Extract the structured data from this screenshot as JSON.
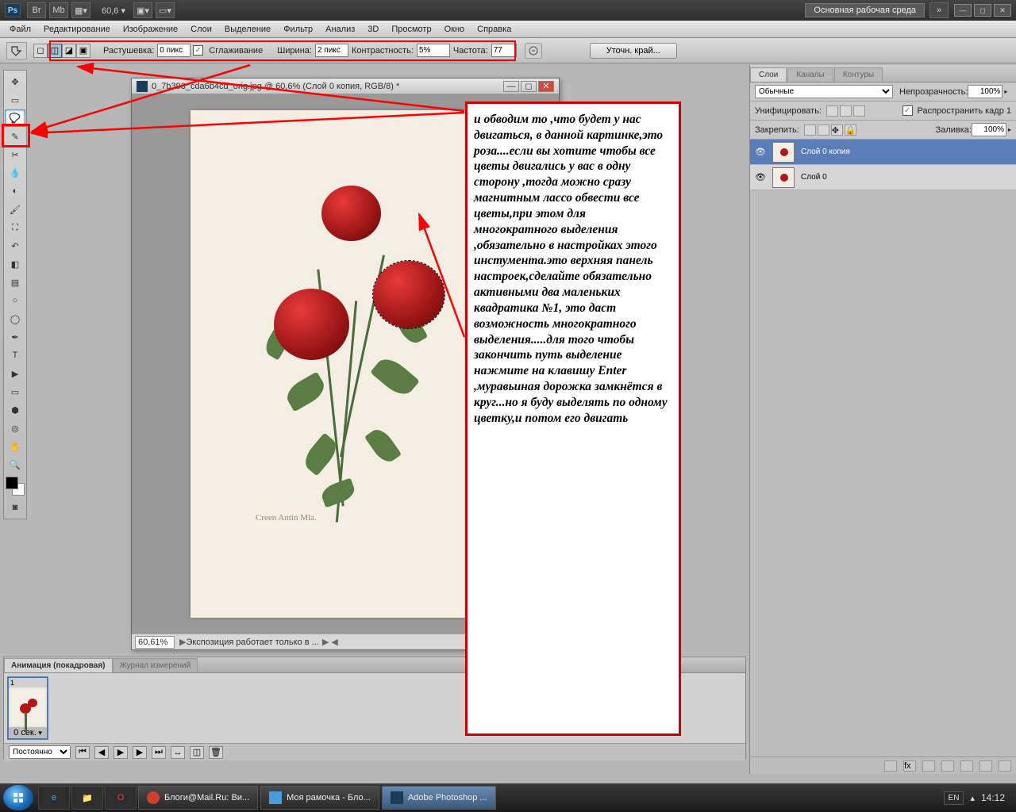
{
  "appbar": {
    "zoom": "60,6",
    "workspace_label": "Основная рабочая среда"
  },
  "menu": [
    "Файл",
    "Редактирование",
    "Изображение",
    "Слои",
    "Выделение",
    "Фильтр",
    "Анализ",
    "3D",
    "Просмотр",
    "Окно",
    "Справка"
  ],
  "options": {
    "feather_label": "Растушевка:",
    "feather_value": "0 пикс",
    "antialias_label": "Сглаживание",
    "width_label": "Ширина:",
    "width_value": "2 пикс",
    "contrast_label": "Контрастность:",
    "contrast_value": "5%",
    "frequency_label": "Частота:",
    "frequency_value": "77",
    "refine_label": "Уточн. край..."
  },
  "document": {
    "title": "0_7b393_cda6b4cd_orig.jpg @ 60,6% (Слой 0 копия, RGB/8) *",
    "status_zoom": "60,61%",
    "status_text": "Экспозиция работает только в ..."
  },
  "layers_panel": {
    "tabs": [
      "Слои",
      "Каналы",
      "Контуры"
    ],
    "blend_mode": "Обычные",
    "opacity_label": "Непрозрачность:",
    "opacity_value": "100%",
    "unify_label": "Унифицировать:",
    "propagate_label": "Распространить кадр 1",
    "lock_label": "Закрепить:",
    "fill_label": "Заливка:",
    "fill_value": "100%",
    "layers": [
      {
        "name": "Слой 0 копия",
        "selected": true
      },
      {
        "name": "Слой 0",
        "selected": false
      }
    ]
  },
  "animation": {
    "tabs": [
      "Анимация (покадровая)",
      "Журнал измерений"
    ],
    "frame_time": "0 сек.",
    "loop": "Постоянно"
  },
  "annotation": "и обводим то ,что будет у нас двигаться, в данной картинке,это роза....если вы хотите чтобы все цветы двигались у вас в одну сторону ,тогда можно сразу магнитным лассо обвести все цветы,при этом для многократного выделения ,обязательно в настройках этого инстумента.это верхняя панель настроек,сделайте обязательно активными два маленьких квадратика №1, это даст возможность многократного выделения.....для того чтобы закончить путь выделение нажмите  на клавишу Enter ,муравьиная дорожка замкнётся в круг...но я буду выделять по одному цветку,и потом его двигать",
  "taskbar": {
    "apps": [
      {
        "label": "Блоги@Mail.Ru: Ви...",
        "icon_color": "#d04030"
      },
      {
        "label": "Моя рамочка - Бло...",
        "icon_color": "#4a9ad8"
      },
      {
        "label": "Adobe Photoshop ...",
        "icon_color": "#1a3e5a",
        "active": true
      }
    ],
    "lang": "EN",
    "time": "14:12"
  }
}
